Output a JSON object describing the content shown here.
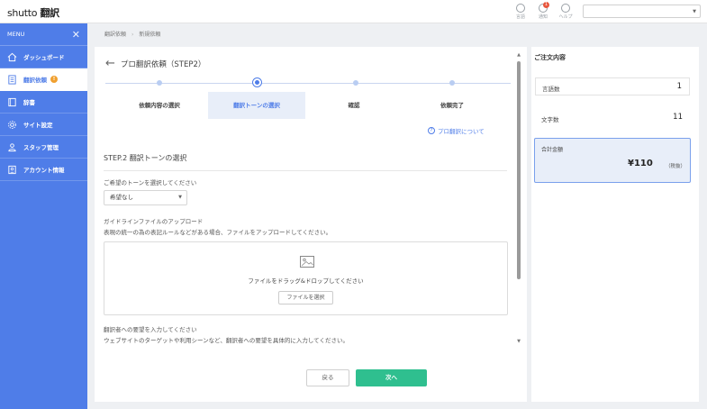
{
  "app": {
    "logo_brand": "shutto",
    "logo_product": "翻訳"
  },
  "topbar": {
    "language_label": "言語",
    "notification_label": "通知",
    "notification_count": "1",
    "help_label": "ヘルプ",
    "account_select_value": ""
  },
  "sidebar": {
    "menu_label": "MENU",
    "items": [
      {
        "label": "ダッシュボード",
        "icon": "home-icon"
      },
      {
        "label": "翻訳依頼",
        "icon": "document-icon",
        "badge": "!"
      },
      {
        "label": "辞書",
        "icon": "book-icon"
      },
      {
        "label": "サイト設定",
        "icon": "gear-icon"
      },
      {
        "label": "スタッフ管理",
        "icon": "users-icon"
      },
      {
        "label": "アカウント情報",
        "icon": "id-card-icon"
      }
    ]
  },
  "breadcrumb": [
    "翻訳依頼",
    "新規依頼"
  ],
  "main": {
    "title": "プロ翻訳依頼（STEP2）",
    "steps": [
      {
        "label": "依頼内容の選択"
      },
      {
        "label": "翻訳トーンの選択"
      },
      {
        "label": "確認"
      },
      {
        "label": "依頼完了"
      }
    ],
    "about_link": "プロ翻訳について",
    "section_title": "STEP.2 翻訳トーンの選択",
    "tone_label": "ご希望のトーンを選択してください",
    "tone_value": "希望なし",
    "guideline_label": "ガイドラインファイルのアップロード",
    "guideline_desc": "表現の統一の為の表記ルールなどがある場合、ファイルをアップロードしてください。",
    "dropzone_text": "ファイルをドラッグ&ドロップしてください",
    "select_file_button": "ファイルを選択",
    "request_label": "翻訳者への要望を入力してください",
    "request_desc": "ウェブサイトのターゲットや利用シーンなど、翻訳者への要望を具体的に入力してください。",
    "back_button": "戻る",
    "next_button": "次へ"
  },
  "summary": {
    "title": "ご注文内容",
    "languages_label": "言語数",
    "languages_value": "1",
    "chars_label": "文字数",
    "chars_value": "11",
    "total_label": "合計金額",
    "total_value": "¥110",
    "tax_note": "（税抜）"
  },
  "colors": {
    "accent": "#4f7de8",
    "next": "#2fbf8f",
    "badge": "#f0a030"
  }
}
